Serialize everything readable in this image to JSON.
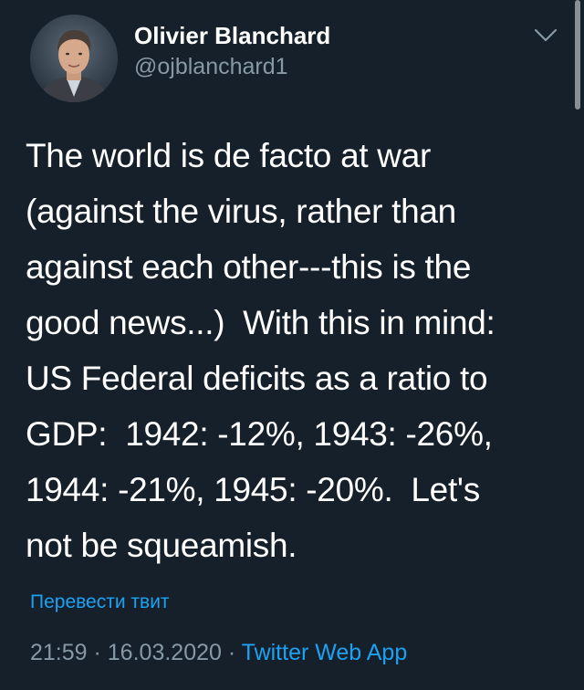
{
  "author": {
    "name": "Olivier Blanchard",
    "handle": "@ojblanchard1"
  },
  "tweet": {
    "text": "The world is de facto at war\n(against the virus, rather than\nagainst each other---this is the\ngood news...)  With this in mind:\nUS Federal deficits as a ratio to\nGDP:  1942: -12%, 1943: -26%,\n1944: -21%, 1945: -20%.  Let's\nnot be squeamish."
  },
  "translate_label": "Перевести твит",
  "meta": {
    "time": "21:59",
    "separator": " · ",
    "date": "16.03.2020",
    "source": "Twitter Web App"
  },
  "icons": {
    "menu": "chevron-down-icon",
    "avatar": "profile-photo"
  },
  "colors": {
    "background": "#15202b",
    "text": "#ffffff",
    "secondary_text": "#8899a6",
    "link": "#1da1f2"
  }
}
